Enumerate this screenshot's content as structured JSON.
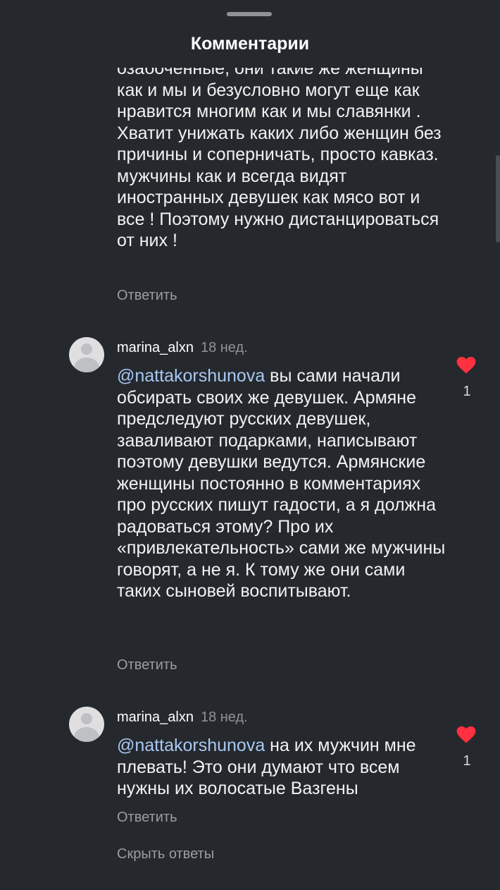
{
  "header": {
    "title": "Комментарии"
  },
  "comments": [
    {
      "text": "озабоченные, они такие же женщины как и мы и безусловно могут еще как нравится многим как и мы славянки . Хватит унижать каких либо женщин без причины и соперничать, просто кавказ. мужчины как и всегда видят иностранных девушек как мясо вот и все ! Поэтому нужно дистанцироваться от них !",
      "reply_label": "Ответить"
    },
    {
      "username": "marina_alxn",
      "time": "18 нед.",
      "mention": "@nattakorshunova",
      "text": " вы сами начали обсирать своих же девушек. Армяне предследуют русских девушек, заваливают подарками, написывают поэтому девушки ведутся. Армянские женщины постоянно в комментариях про русских пишут гадости, а я должна радоваться этому? Про их «привлекательность» сами же мужчины говорят, а не я. К тому же они сами таких сыновей воспитывают.",
      "likes": "1",
      "reply_label": "Ответить",
      "like_color": "#ff3040"
    },
    {
      "username": "marina_alxn",
      "time": "18 нед.",
      "mention": "@nattakorshunova",
      "text": " на их мужчин мне плевать! Это они думают что всем нужны их волосатые Вазгены",
      "likes": "1",
      "reply_label": "Ответить",
      "like_color": "#ff3040"
    }
  ],
  "hide_replies_label": "Скрыть ответы",
  "icons": {
    "heart": "heart-icon",
    "avatar": "default-avatar-icon",
    "handle": "grab-handle"
  },
  "colors": {
    "background": "#25282d",
    "mention": "#a8c8f2",
    "like": "#ff3040",
    "muted": "#9a9da2"
  }
}
